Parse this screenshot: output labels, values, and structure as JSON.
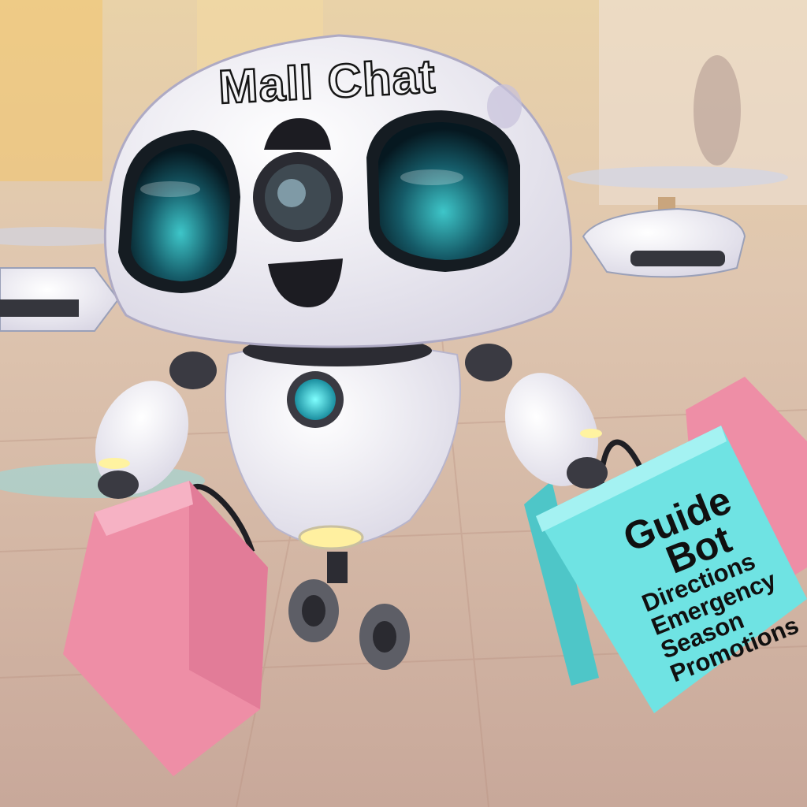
{
  "robot": {
    "head_label": "Mall Chat"
  },
  "bag": {
    "title_line1": "Guide",
    "title_line2": "Bot",
    "items": [
      "Directions",
      "Emergency",
      "Season",
      "Promotions"
    ]
  },
  "palette": {
    "background": "#d8c4b4",
    "robot_white": "#f2f1f6",
    "lens": "#1b6e7a",
    "bag_pink": "#ee8ea6",
    "bag_cyan": "#6fe3e3"
  }
}
